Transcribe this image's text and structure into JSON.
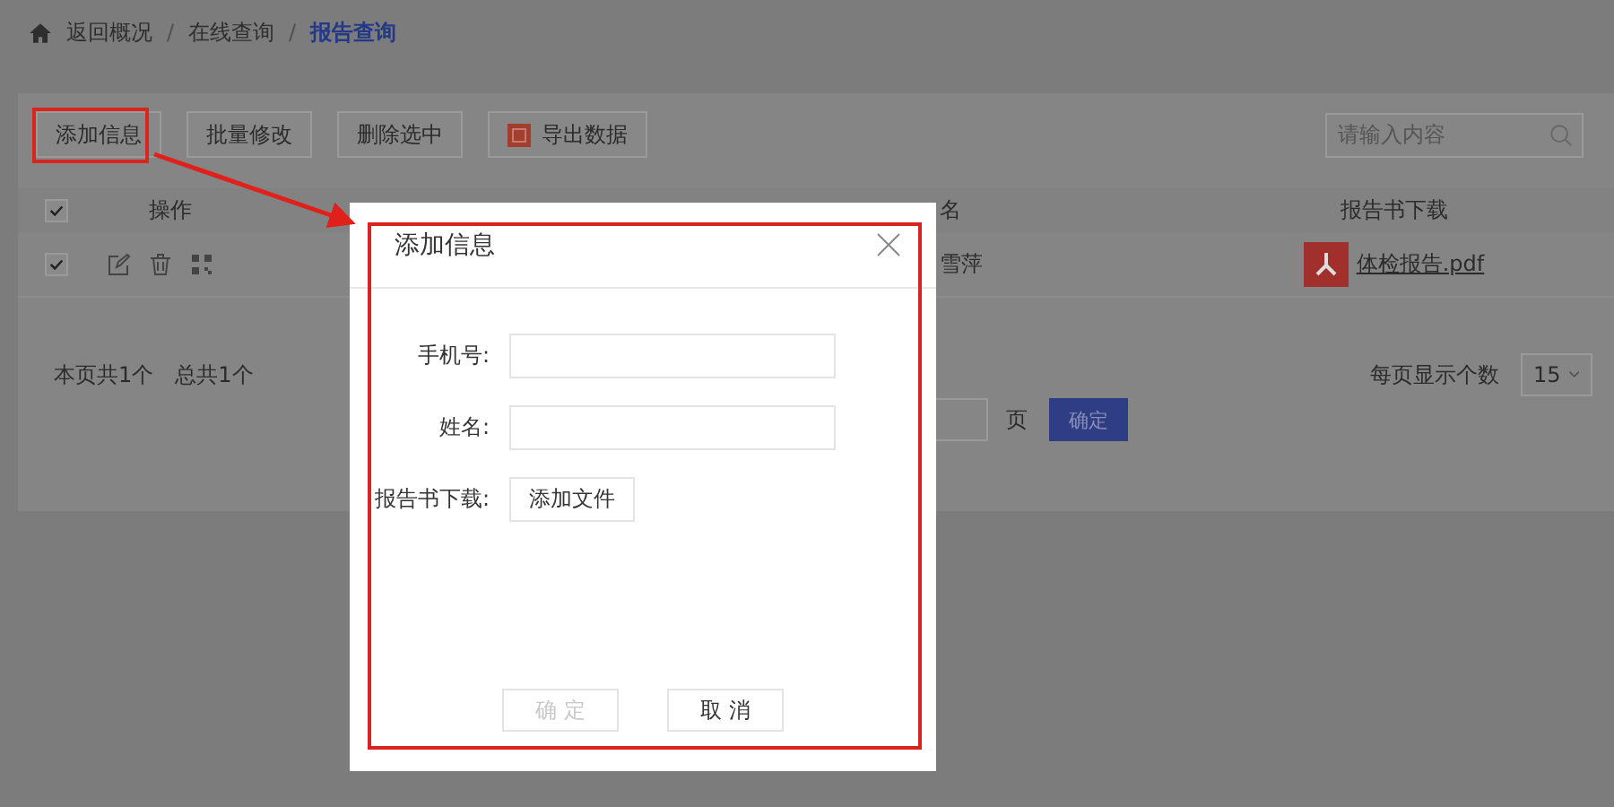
{
  "breadcrumb": [
    {
      "label": "返回概况",
      "selected": false
    },
    {
      "separator": "/",
      "label": "在线查询",
      "selected": false
    },
    {
      "separator": "/",
      "label": "报告查询",
      "selected": true
    }
  ],
  "toolbar": {
    "buttons": [
      {
        "label": "添加信息",
        "kind": "plain"
      },
      {
        "label": "批量修改",
        "kind": "plain"
      },
      {
        "label": "删除选中",
        "kind": "plain"
      },
      {
        "label": "导出数据",
        "kind": "export"
      }
    ]
  },
  "search": {
    "placeholder": "请输入内容"
  },
  "table": {
    "header_checked": true,
    "columns": [
      "操作",
      "名",
      "报告书下载"
    ],
    "rows": [
      {
        "checked": true,
        "name": "雪萍",
        "file": "体检报告.pdf"
      }
    ]
  },
  "footer": {
    "page_count": "本页共1个",
    "total_count": "总共1个",
    "page_size_label": "每页显示个数",
    "page_size": "15",
    "jump_unit": "页",
    "jump_button": "确定"
  },
  "dialog": {
    "title": "添加信息",
    "fields": [
      {
        "label": "手机号:",
        "kind": "text"
      },
      {
        "label": "姓名:",
        "kind": "text"
      },
      {
        "label": "报告书下载:",
        "kind": "file",
        "button": "添加文件"
      }
    ],
    "buttons": [
      {
        "label": "确 定",
        "disabled": true
      },
      {
        "label": "取 消",
        "disabled": false
      }
    ]
  }
}
